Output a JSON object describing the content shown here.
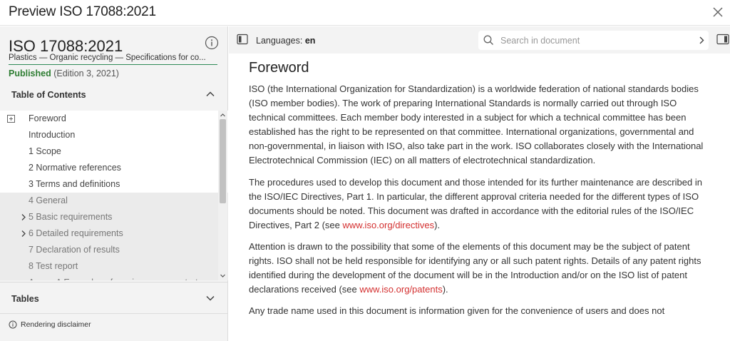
{
  "window": {
    "title": "Preview ISO 17088:2021"
  },
  "sidebar": {
    "doc_title": "ISO 17088:2021",
    "doc_subtitle": "Plastics — Organic recycling — Specifications for co...",
    "status": "Published",
    "edition": "(Edition 3, 2021)",
    "toc_heading": "Table of Contents",
    "toc_items": [
      {
        "label": "Foreword",
        "style": "w",
        "expand": true,
        "arrow": false
      },
      {
        "label": "Introduction",
        "style": "w",
        "expand": false,
        "arrow": false
      },
      {
        "label": "1 Scope",
        "style": "w",
        "expand": false,
        "arrow": false
      },
      {
        "label": "2 Normative references",
        "style": "w",
        "expand": false,
        "arrow": false
      },
      {
        "label": "3 Terms and definitions",
        "style": "w",
        "expand": false,
        "arrow": false
      },
      {
        "label": "4 General",
        "style": "g",
        "expand": false,
        "arrow": false
      },
      {
        "label": "5 Basic requirements",
        "style": "g",
        "expand": false,
        "arrow": true
      },
      {
        "label": "6 Detailed requirements",
        "style": "g",
        "expand": false,
        "arrow": true
      },
      {
        "label": "7 Declaration of results",
        "style": "g",
        "expand": false,
        "arrow": false
      },
      {
        "label": "8 Test report",
        "style": "g",
        "expand": false,
        "arrow": false
      },
      {
        "label": "Annex A Examples of maximum concentrat...",
        "style": "g",
        "expand": false,
        "arrow": false
      }
    ],
    "tables_heading": "Tables",
    "disclaimer": "Rendering disclaimer"
  },
  "toolbar": {
    "languages_label": "Languages:",
    "language_value": "en",
    "search_placeholder": "Search in document"
  },
  "content": {
    "heading": "Foreword",
    "p1": "ISO (the International Organization for Standardization) is a worldwide federation of national standards bodies (ISO member bodies). The work of preparing International Standards is normally carried out through ISO technical committees. Each member body interested in a subject for which a technical committee has been established has the right to be represented on that committee. International organizations, governmental and non-governmental, in liaison with ISO, also take part in the work. ISO collaborates closely with the International Electrotechnical Commission (IEC) on all matters of electrotechnical standardization.",
    "p2_text": "The procedures used to develop this document and those intended for its further maintenance are described in the ISO/IEC Directives, Part 1. In particular, the different approval criteria needed for the different types of ISO documents should be noted. This document was drafted in accordance with the editorial rules of the ISO/IEC Directives, Part 2 (see ",
    "p2_link": "www.iso.org/directives",
    "p2_end": ").",
    "p3_text": "Attention is drawn to the possibility that some of the elements of this document may be the subject of patent rights. ISO shall not be held responsible for identifying any or all such patent rights. Details of any patent rights identified during the development of the document will be in the Introduction and/or on the ISO list of patent declarations received (see ",
    "p3_link": "www.iso.org/patents",
    "p3_end": ").",
    "p4": "Any trade name used in this document is information given for the convenience of users and does not"
  }
}
